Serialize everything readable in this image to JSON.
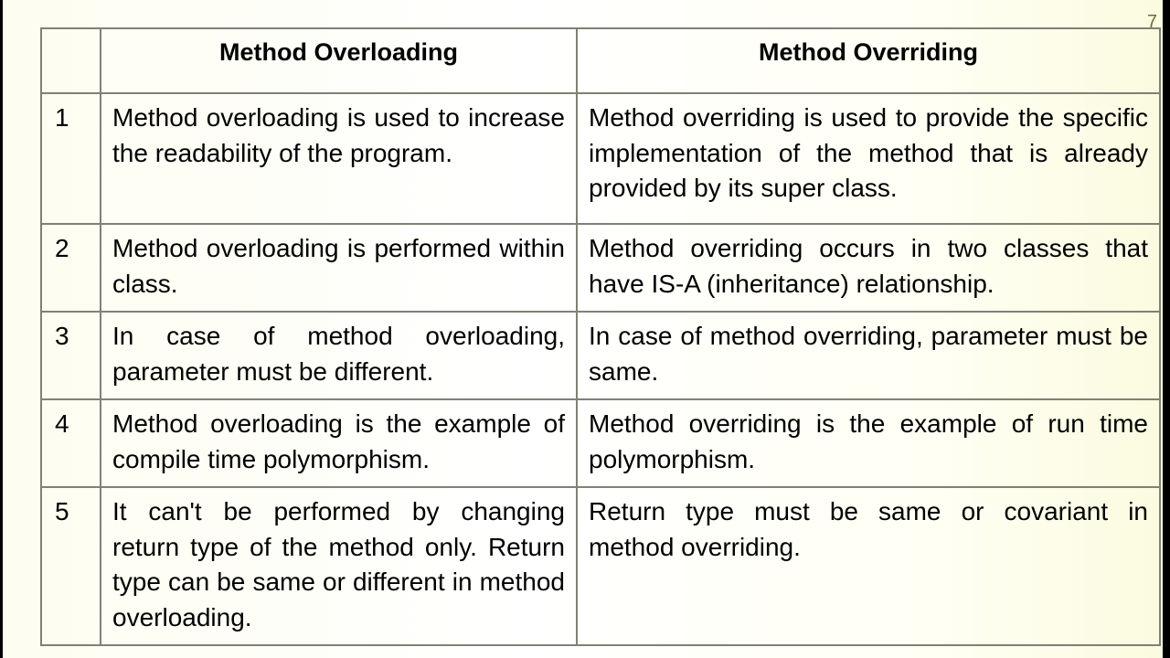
{
  "slide": {
    "page_number": "7"
  },
  "table": {
    "headers": [
      "",
      "Method Overloading",
      "Method Overriding"
    ],
    "rows": [
      {
        "num": "1",
        "overloading": "Method overloading is used to increase the readability of the program.",
        "overriding": "Method overriding is used to provide the specific implementation of the method that is already provided by its super class."
      },
      {
        "num": "2",
        "overloading": "Method overloading is performed within class.",
        "overriding": "Method overriding occurs in two classes that have IS-A (inheritance) relationship."
      },
      {
        "num": "3",
        "overloading": "In case of method overloading, parameter must be different.",
        "overriding": "In case of method overriding, parameter must be same."
      },
      {
        "num": "4",
        "overloading": "Method overloading is the example of compile time polymorphism.",
        "overriding": "Method overriding is the example of run time polymorphism."
      },
      {
        "num": "5",
        "overloading": "It can't be performed by changing return type of the method only. Return type can be same or different in method overloading.",
        "overriding": "Return type must be same or covariant in method overriding."
      }
    ]
  }
}
